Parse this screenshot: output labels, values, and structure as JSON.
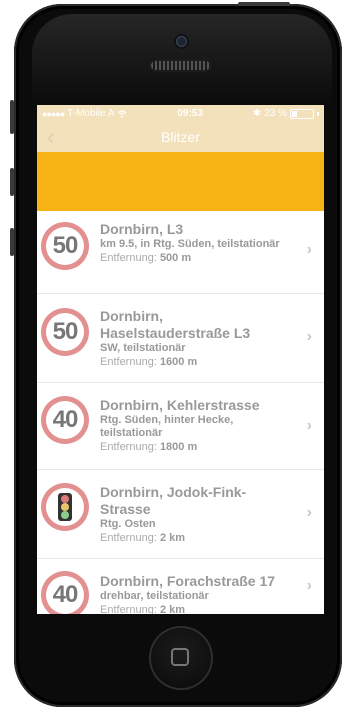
{
  "status": {
    "carrier": "T-Mobile A",
    "time": "09:53",
    "battery": "23 %",
    "signal_dots": "●●●●●"
  },
  "nav": {
    "back_glyph": "‹",
    "title": "Blitzer"
  },
  "colors": {
    "accent": "#f8b315",
    "bar": "#f2e1ba"
  },
  "list": [
    {
      "sign": "50",
      "title": "Dornbirn, L3",
      "sub": "km 9.5, in Rtg. Süden, teilstationär",
      "dist_label": "Entfernung:",
      "dist": "500 m"
    },
    {
      "sign": "50",
      "title": "Dornbirn, Haselstauderstraße L3",
      "sub": "SW, teilstationär",
      "dist_label": "Entfernung:",
      "dist": "1600 m"
    },
    {
      "sign": "40",
      "title": "Dornbirn, Kehlerstrasse",
      "sub": "Rtg. Süden, hinter Hecke, teilstationär",
      "dist_label": "Entfernung:",
      "dist": "1800 m"
    },
    {
      "sign": "traffic-light",
      "title": "Dornbirn, Jodok-Fink-Strasse",
      "sub": "Rtg. Osten",
      "dist_label": "Entfernung:",
      "dist": "2 km"
    },
    {
      "sign": "40",
      "title": "Dornbirn, Forachstraße 17",
      "sub": "drehbar, teilstationär",
      "dist_label": "Entfernung:",
      "dist": "2 km"
    }
  ]
}
